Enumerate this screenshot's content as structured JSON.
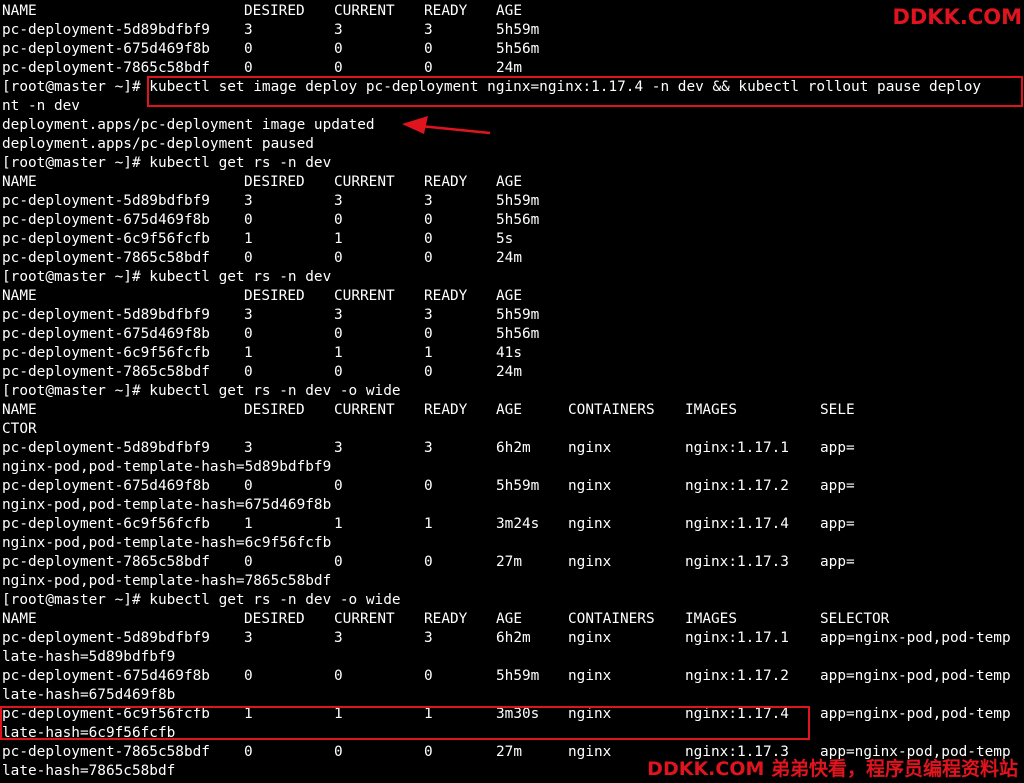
{
  "terminal": {
    "lines": [
      {
        "cells": [
          "NAME",
          "DESIRED",
          "CURRENT",
          "READY",
          "AGE"
        ]
      },
      {
        "cells": [
          "pc-deployment-5d89bdfbf9",
          "3",
          "3",
          "3",
          "5h59m"
        ]
      },
      {
        "cells": [
          "pc-deployment-675d469f8b",
          "0",
          "0",
          "0",
          "5h56m"
        ]
      },
      {
        "cells": [
          "pc-deployment-7865c58bdf",
          "0",
          "0",
          "0",
          "24m"
        ]
      },
      {
        "text": "[root@master ~]# kubectl set image deploy pc-deployment nginx=nginx:1.17.4 -n dev && kubectl rollout pause deploy"
      },
      {
        "text": "nt -n dev"
      },
      {
        "text": "deployment.apps/pc-deployment image updated"
      },
      {
        "text": "deployment.apps/pc-deployment paused"
      },
      {
        "text": "[root@master ~]# kubectl get rs -n dev"
      },
      {
        "cells": [
          "NAME",
          "DESIRED",
          "CURRENT",
          "READY",
          "AGE"
        ]
      },
      {
        "cells": [
          "pc-deployment-5d89bdfbf9",
          "3",
          "3",
          "3",
          "5h59m"
        ]
      },
      {
        "cells": [
          "pc-deployment-675d469f8b",
          "0",
          "0",
          "0",
          "5h56m"
        ]
      },
      {
        "cells": [
          "pc-deployment-6c9f56fcfb",
          "1",
          "1",
          "0",
          "5s"
        ]
      },
      {
        "cells": [
          "pc-deployment-7865c58bdf",
          "0",
          "0",
          "0",
          "24m"
        ]
      },
      {
        "text": "[root@master ~]# kubectl get rs -n dev"
      },
      {
        "cells": [
          "NAME",
          "DESIRED",
          "CURRENT",
          "READY",
          "AGE"
        ]
      },
      {
        "cells": [
          "pc-deployment-5d89bdfbf9",
          "3",
          "3",
          "3",
          "5h59m"
        ]
      },
      {
        "cells": [
          "pc-deployment-675d469f8b",
          "0",
          "0",
          "0",
          "5h56m"
        ]
      },
      {
        "cells": [
          "pc-deployment-6c9f56fcfb",
          "1",
          "1",
          "1",
          "41s"
        ]
      },
      {
        "cells": [
          "pc-deployment-7865c58bdf",
          "0",
          "0",
          "0",
          "24m"
        ]
      },
      {
        "text": "[root@master ~]# kubectl get rs -n dev -o wide"
      },
      {
        "cells": [
          "NAME",
          "DESIRED",
          "CURRENT",
          "READY",
          "AGE",
          "CONTAINERS",
          "IMAGES",
          "SELE"
        ]
      },
      {
        "text": "CTOR"
      },
      {
        "cells": [
          "pc-deployment-5d89bdfbf9",
          "3",
          "3",
          "3",
          "6h2m",
          "nginx",
          "nginx:1.17.1",
          "app="
        ]
      },
      {
        "text": "nginx-pod,pod-template-hash=5d89bdfbf9"
      },
      {
        "cells": [
          "pc-deployment-675d469f8b",
          "0",
          "0",
          "0",
          "5h59m",
          "nginx",
          "nginx:1.17.2",
          "app="
        ]
      },
      {
        "text": "nginx-pod,pod-template-hash=675d469f8b"
      },
      {
        "cells": [
          "pc-deployment-6c9f56fcfb",
          "1",
          "1",
          "1",
          "3m24s",
          "nginx",
          "nginx:1.17.4",
          "app="
        ]
      },
      {
        "text": "nginx-pod,pod-template-hash=6c9f56fcfb"
      },
      {
        "cells": [
          "pc-deployment-7865c58bdf",
          "0",
          "0",
          "0",
          "27m",
          "nginx",
          "nginx:1.17.3",
          "app="
        ]
      },
      {
        "text": "nginx-pod,pod-template-hash=7865c58bdf"
      },
      {
        "text": "[root@master ~]# kubectl get rs -n dev -o wide"
      },
      {
        "cells": [
          "NAME",
          "DESIRED",
          "CURRENT",
          "READY",
          "AGE",
          "CONTAINERS",
          "IMAGES",
          "SELECTOR"
        ]
      },
      {
        "cells": [
          "pc-deployment-5d89bdfbf9",
          "3",
          "3",
          "3",
          "6h2m",
          "nginx",
          "nginx:1.17.1",
          "app=nginx-pod,pod-temp"
        ]
      },
      {
        "text": "late-hash=5d89bdfbf9"
      },
      {
        "cells": [
          "pc-deployment-675d469f8b",
          "0",
          "0",
          "0",
          "5h59m",
          "nginx",
          "nginx:1.17.2",
          "app=nginx-pod,pod-temp"
        ]
      },
      {
        "text": "late-hash=675d469f8b"
      },
      {
        "cells": [
          "pc-deployment-6c9f56fcfb",
          "1",
          "1",
          "1",
          "3m30s",
          "nginx",
          "nginx:1.17.4",
          "app=nginx-pod,pod-temp"
        ]
      },
      {
        "text": "late-hash=6c9f56fcfb"
      },
      {
        "cells": [
          "pc-deployment-7865c58bdf",
          "0",
          "0",
          "0",
          "27m",
          "nginx",
          "nginx:1.17.3",
          "app=nginx-pod,pod-temp"
        ]
      },
      {
        "text": "late-hash=7865c58bdf"
      }
    ]
  },
  "watermarks": {
    "top": "DDKK.COM",
    "bottom": "DDKK.COM 弟弟快看，程序员编程资料站"
  },
  "colors": {
    "background": "#000000",
    "text": "#ffffff",
    "annotation": "#e0141e"
  }
}
